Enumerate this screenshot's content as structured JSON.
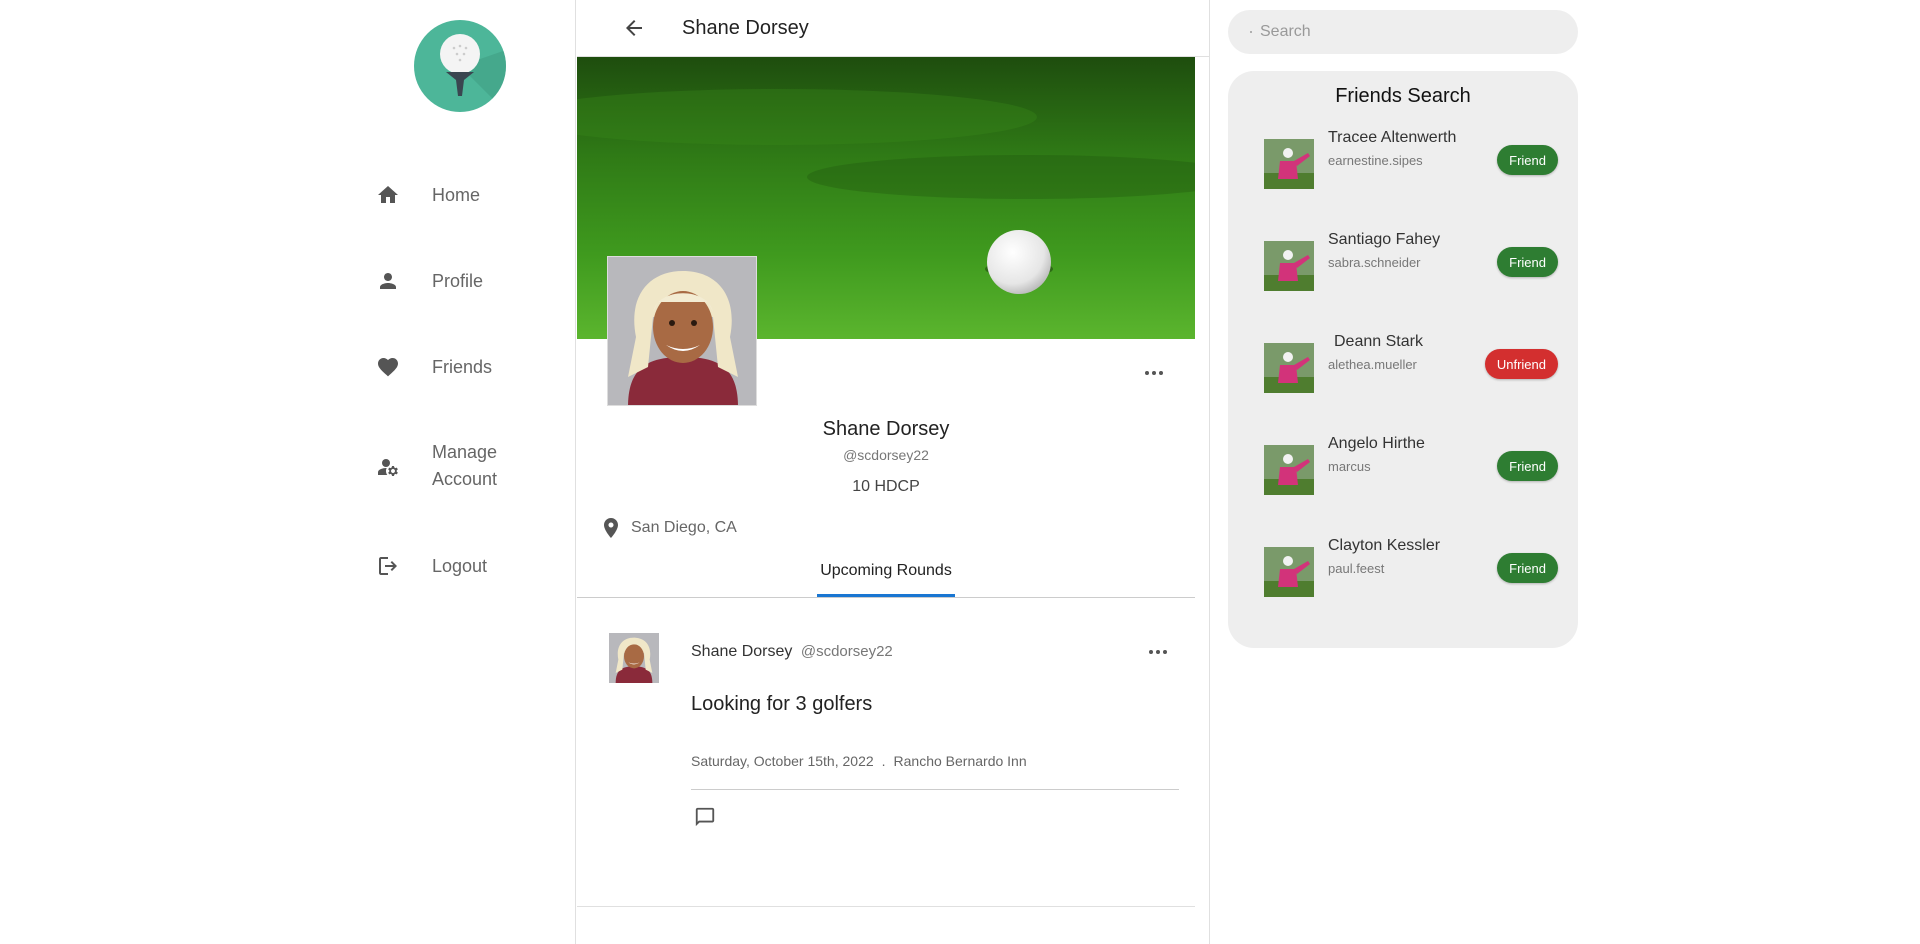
{
  "colors": {
    "logo_bg": "#4db699",
    "tab_accent": "#1976d2",
    "friend_button": "#2e7d32",
    "unfriend_button": "#d32f2f",
    "panel_bg": "#eeeeee"
  },
  "sidebar": {
    "logo_icon": "golf-ball-on-tee-icon",
    "items": [
      {
        "label": "Home",
        "icon": "home-icon"
      },
      {
        "label": "Profile",
        "icon": "person-icon"
      },
      {
        "label": "Friends",
        "icon": "heart-icon"
      },
      {
        "label": "Manage Account",
        "icon": "manage-account-icon"
      },
      {
        "label": "Logout",
        "icon": "logout-icon"
      }
    ]
  },
  "header": {
    "title": "Shane Dorsey",
    "back_icon": "arrow-left-icon"
  },
  "profile": {
    "name": "Shane Dorsey",
    "handle": "@scdorsey22",
    "hdcp": "10 HDCP",
    "location": "San Diego, CA",
    "location_icon": "location-pin-icon",
    "more_icon": "more-horizontal-icon"
  },
  "tabs": [
    {
      "label": "Upcoming Rounds",
      "active": true
    }
  ],
  "post": {
    "author": "Shane Dorsey",
    "handle": "@scdorsey22",
    "body": "Looking for 3 golfers",
    "date": "Saturday, October 15th, 2022",
    "separator": ".",
    "course": "Rancho Bernardo Inn",
    "comment_icon": "comment-icon"
  },
  "search": {
    "placeholder": "Search",
    "value": ""
  },
  "friends_search": {
    "title": "Friends Search",
    "friends": [
      {
        "name": "Tracee Altenwerth",
        "username": "earnestine.sipes",
        "action": "Friend"
      },
      {
        "name": "Santiago Fahey",
        "username": "sabra.schneider",
        "action": "Friend"
      },
      {
        "name": "Deann Stark",
        "username": "alethea.mueller",
        "action": "Unfriend"
      },
      {
        "name": "Angelo Hirthe",
        "username": "marcus",
        "action": "Friend"
      },
      {
        "name": "Clayton Kessler",
        "username": "paul.feest",
        "action": "Friend"
      }
    ]
  }
}
